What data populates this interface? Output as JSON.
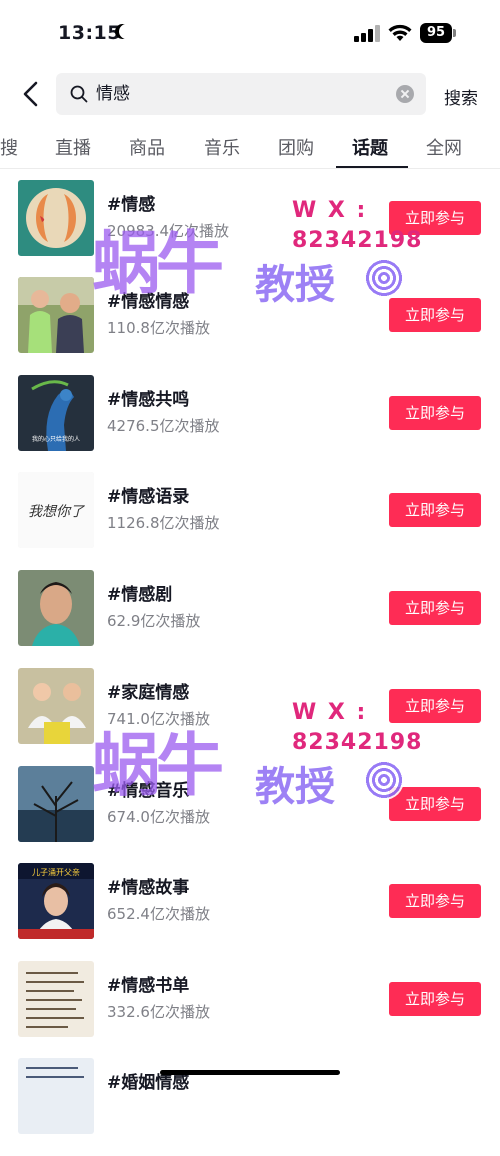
{
  "status_bar": {
    "time": "13:15",
    "battery": "95"
  },
  "search": {
    "query": "情感",
    "button": "搜索"
  },
  "tabs": [
    "搜",
    "直播",
    "商品",
    "音乐",
    "团购",
    "话题",
    "全网"
  ],
  "active_tab": "话题",
  "join_label": "立即参与",
  "topics": [
    {
      "title": "#情感",
      "plays": "20983.4亿次播放"
    },
    {
      "title": "#情感情感",
      "plays": "110.8亿次播放"
    },
    {
      "title": "#情感共鸣",
      "plays": "4276.5亿次播放"
    },
    {
      "title": "#情感语录",
      "plays": "1126.8亿次播放"
    },
    {
      "title": "#情感剧",
      "plays": "62.9亿次播放"
    },
    {
      "title": "#家庭情感",
      "plays": "741.0亿次播放"
    },
    {
      "title": "#情感音乐",
      "plays": "674.0亿次播放"
    },
    {
      "title": "#情感故事",
      "plays": "652.4亿次播放"
    },
    {
      "title": "#情感书单",
      "plays": "332.6亿次播放"
    },
    {
      "title": "#婚姻情感",
      "plays": ""
    }
  ],
  "watermark": {
    "big": "蜗牛",
    "mid": "教授",
    "wx": "W X :",
    "number": "82342198"
  },
  "thumb_texts": {
    "peacock_caption": "我的心只给我的人",
    "handwriting": "我想你了",
    "news_banner": "儿子涌开父亲"
  },
  "colors": {
    "accent": "#fe2c55",
    "watermark_purple": "#9b5cf0",
    "watermark_pink": "#e0287c"
  }
}
